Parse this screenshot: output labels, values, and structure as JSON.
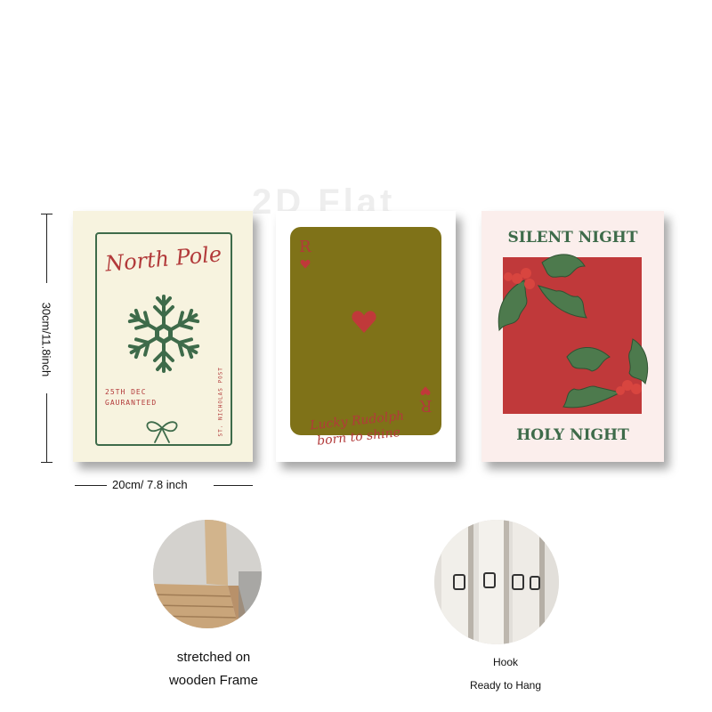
{
  "watermark": "2D Flat",
  "dimensions": {
    "height_label": "30cm/11.8inch",
    "width_label": "20cm/ 7.8 inch"
  },
  "prints": {
    "north_pole": {
      "title": "North Pole",
      "date_line_1": "25TH DEC",
      "date_line_2": "GAURANTEED",
      "side_text": "ST. NICHOLAS POST"
    },
    "playing_card": {
      "corner_letter": "R",
      "line_1": "Lucky Rudolph",
      "line_2": "born to shine"
    },
    "silent_night": {
      "top_text": "SILENT NIGHT",
      "bottom_text": "HOLY NIGHT"
    }
  },
  "features": {
    "frame": {
      "line_1": "stretched on",
      "line_2": "wooden Frame"
    },
    "hook": {
      "line_1": "Hook",
      "line_2": "Ready to Hang"
    }
  },
  "colors": {
    "cream": "#f7f3df",
    "green": "#3e6b4a",
    "red": "#b23a3a",
    "olive": "#7f7218",
    "holly_red": "#c0393a",
    "blush": "#fbeeec"
  }
}
